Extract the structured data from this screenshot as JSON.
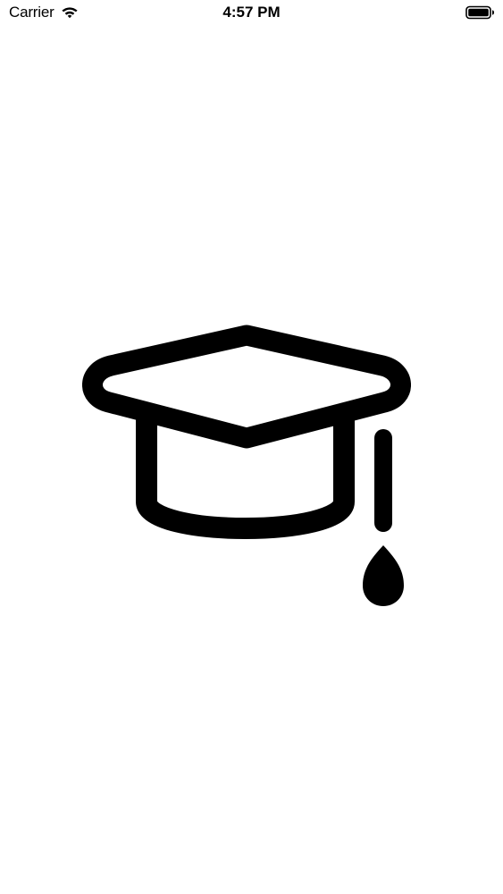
{
  "status_bar": {
    "carrier": "Carrier",
    "time": "4:57 PM",
    "wifi_icon": "wifi-icon",
    "battery_icon": "battery-icon"
  },
  "main": {
    "icon": "graduation-cap-icon"
  },
  "colors": {
    "background": "#ffffff",
    "foreground": "#000000"
  }
}
